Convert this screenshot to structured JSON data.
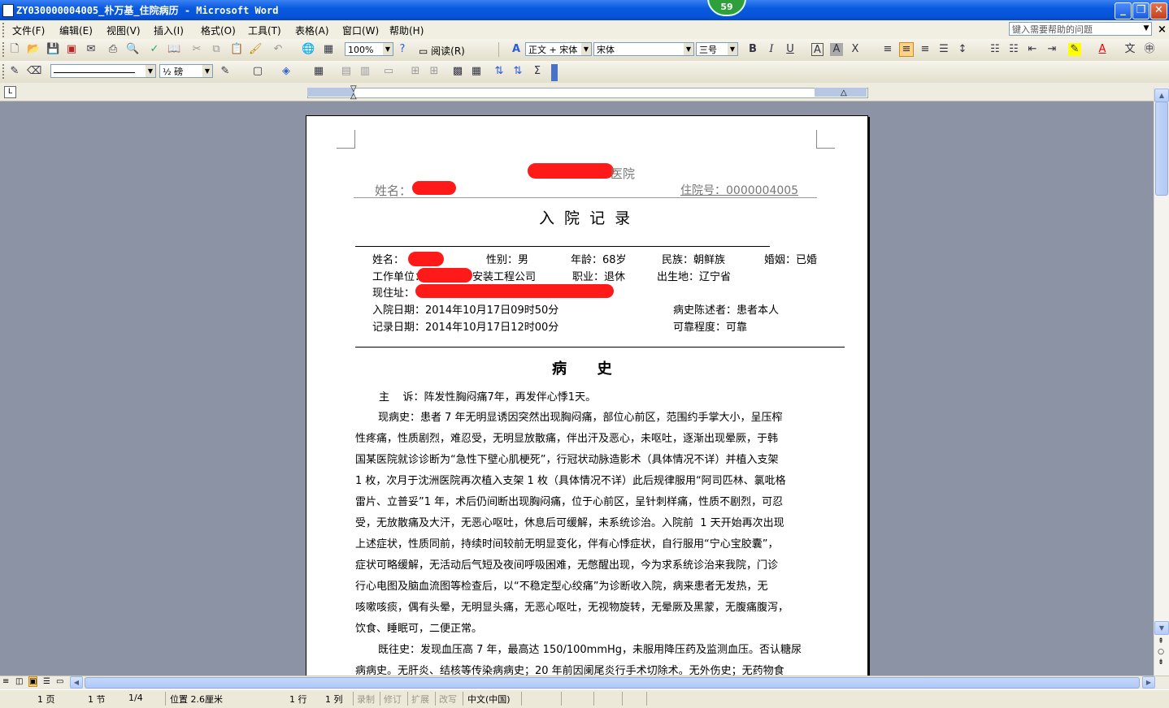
{
  "window": {
    "title": "ZY030000004005_朴万基_住院病历 - Microsoft Word",
    "badge": "59",
    "min": "_",
    "max": "❐",
    "close": "✕"
  },
  "menu": {
    "items": [
      "文件(F)",
      "编辑(E)",
      "视图(V)",
      "插入(I)",
      "格式(O)",
      "工具(T)",
      "表格(A)",
      "窗口(W)",
      "帮助(H)"
    ],
    "help_placeholder": "键入需要帮助的问题",
    "close": "×"
  },
  "toolbar": {
    "zoom": "100%",
    "read_label": "阅读(R)",
    "style": "正文 + 宋体",
    "font": "宋体",
    "size": "三号",
    "line_weight": "½ 磅",
    "sum": "Σ"
  },
  "doc": {
    "hospital_suffix": "医院",
    "header_name_label": "姓名：",
    "header_admission_no": "住院号：0000004005",
    "title": "入  院  记  录",
    "name_label": "姓名：",
    "gender": "性别：男",
    "age": "年龄：68岁",
    "ethnicity": "民族：朝鲜族",
    "marital": "婚姻：已婚",
    "work_unit_label": "工作单位：",
    "work_unit_suffix": "安装工程公司",
    "occupation": "职业：退休",
    "birthplace": "出生地：辽宁省",
    "address_label": "现住址：",
    "admit_date": "入院日期：2014年10月17日09时50分",
    "narrator": "病史陈述者：患者本人",
    "record_date": "记录日期：2014年10月17日12时00分",
    "reliability": "可靠程度：可靠",
    "section_title": "病      史",
    "chief_complaint": "主    诉：阵发性胸闷痛7年，再发伴心悸1天。",
    "hpi_lines": [
      "现病史：患者 7 年无明显诱因突然出现胸闷痛，部位心前区，范围约手掌大小，呈压榨",
      "性疼痛，性质剧烈，难忍受，无明显放散痛，伴出汗及恶心，未呕吐，逐渐出现晕厥，于韩",
      "国某医院就诊诊断为“急性下壁心肌梗死”，行冠状动脉造影术（具体情况不详）并植入支架",
      "1 枚，次月于沈洲医院再次植入支架 1 枚（具体情况不详）此后规律服用“阿司匹林、氯吡格",
      "雷片、立普妥”1 年，术后仍间断出现胸闷痛，位于心前区，呈针刺样痛，性质不剧烈，可忍",
      "受，无放散痛及大汗，无恶心呕吐，休息后可缓解，未系统诊治。入院前  1 天开始再次出现",
      "上述症状，性质同前，持续时间较前无明显变化，伴有心悸症状，自行服用“宁心宝胶囊”，",
      "症状可略缓解，无活动后气短及夜间呼吸困难，无憋醒出现，今为求系统诊治来我院，门诊",
      "行心电图及脑血流图等检查后，以“不稳定型心绞痛”为诊断收入院，病来患者无发热，无",
      "咳嗽咳痰，偶有头晕，无明显头痛，无恶心呕吐，无视物旋转，无晕厥及黑蒙，无腹痛腹泻，",
      "饮食、睡眠可，二便正常。"
    ],
    "pmh_lines": [
      "既往史：发现血压高 7 年，最高达 150/100mmHg，未服用降压药及监测血压。否认糖尿",
      "病病史。无肝炎、结核等传染病病史；20 年前因阑尾炎行手术切除术。无外伤史；无药物食"
    ]
  },
  "status": {
    "page": "1 页",
    "section": "1 节",
    "pages": "1/4",
    "position": "位置 2.6厘米",
    "line": "1 行",
    "column": "1 列",
    "rec": "录制",
    "trk": "修订",
    "ext": "扩展",
    "ovr": "改写",
    "lang": "中文(中国)"
  },
  "colors": {
    "redaction": "#ff1a1a",
    "titlebar": "#0654d9",
    "page_bg": "#8b93a5"
  }
}
